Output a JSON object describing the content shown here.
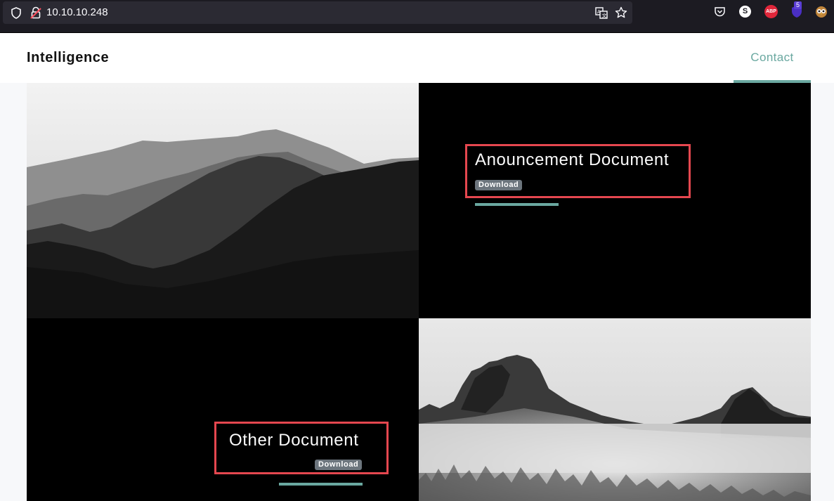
{
  "browser": {
    "url": "10.10.10.248",
    "icons": {
      "tracking": "shield-icon",
      "security": "insecure-lock-icon",
      "translate": "translate-icon",
      "bookmark": "star-icon"
    },
    "extensions": {
      "pocket": "pocket-icon",
      "s_label": "S",
      "abp_label": "ABP",
      "ublock_count": "5",
      "owl": "owl-icon"
    }
  },
  "site": {
    "brand": "Intelligence",
    "nav": {
      "contact": "Contact"
    },
    "accent_color": "#6aa8a0"
  },
  "documents": [
    {
      "title": "Anouncement Document",
      "download_label": "Download"
    },
    {
      "title": "Other Document",
      "download_label": "Download"
    }
  ],
  "annotation_color": "#e5474f"
}
